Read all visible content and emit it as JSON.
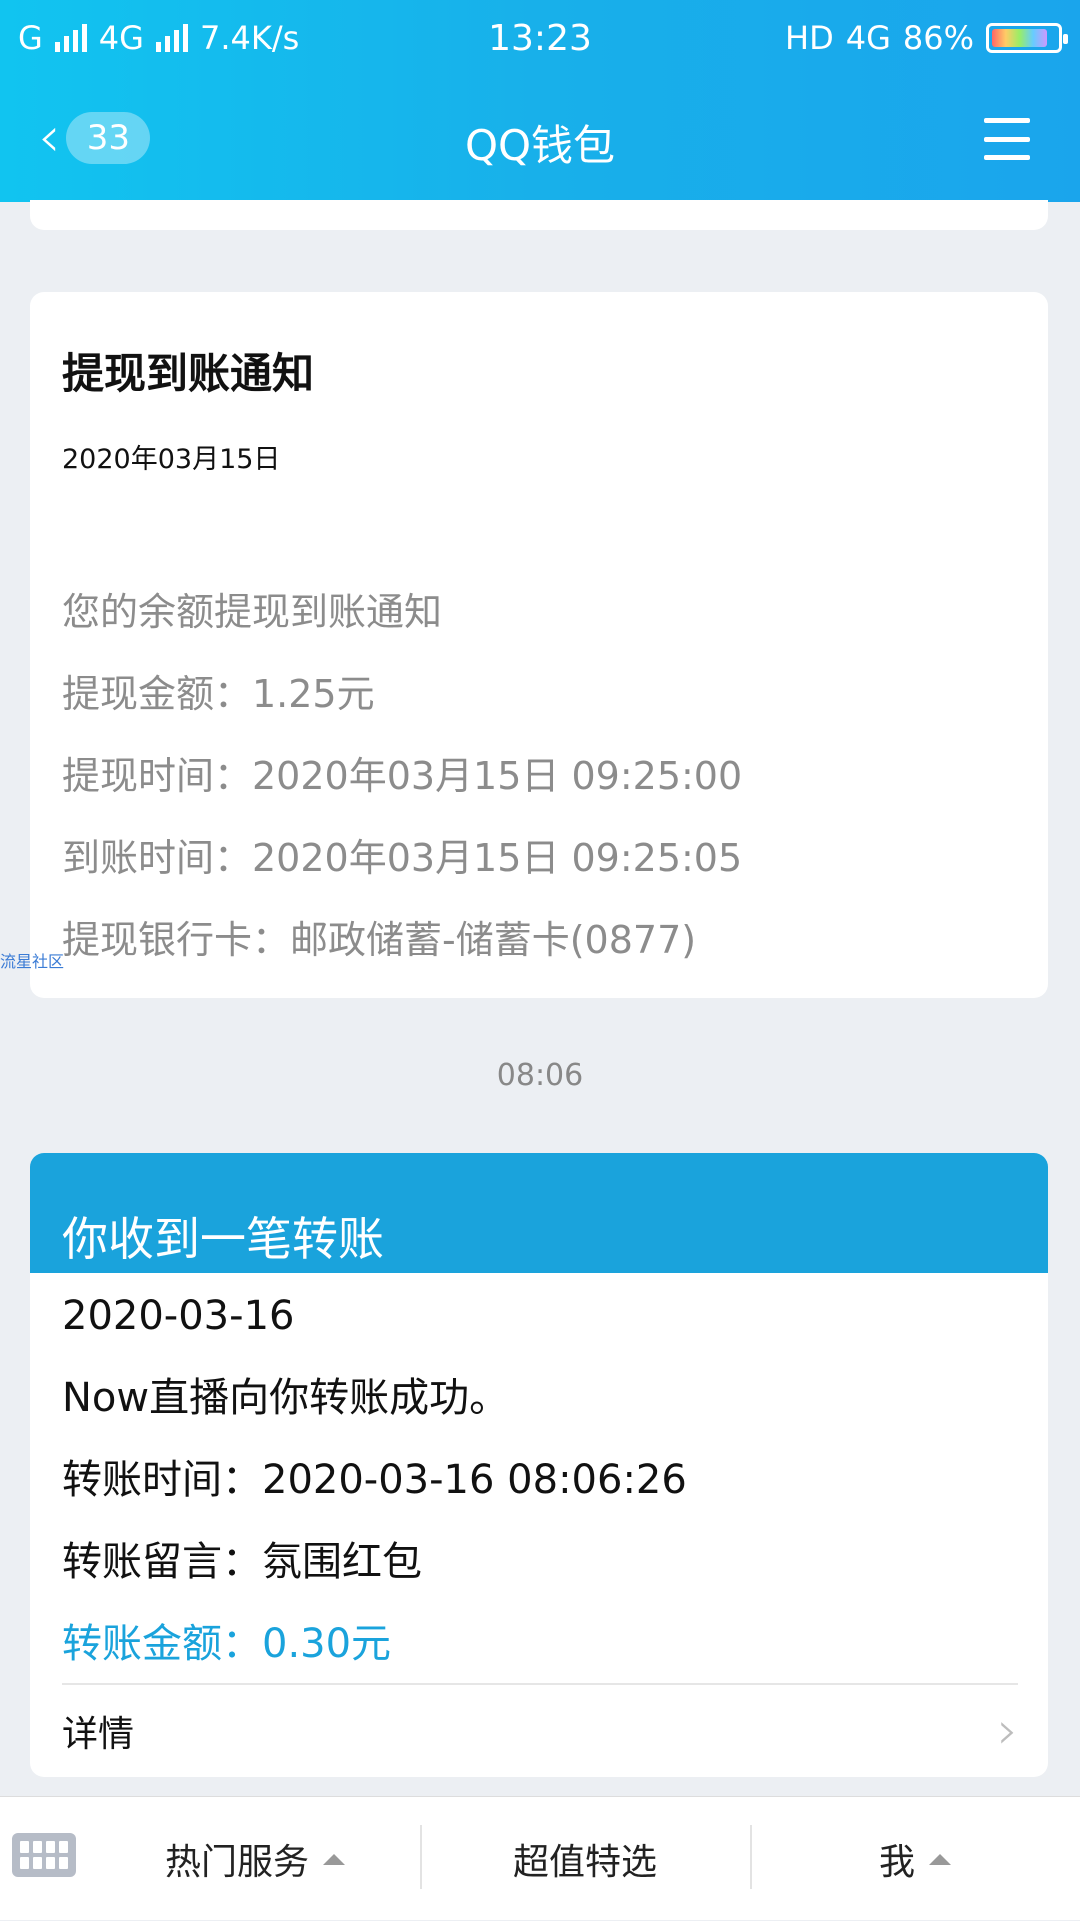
{
  "status_bar": {
    "carrier": "G",
    "network": "4G",
    "speed": "7.4K/s",
    "time": "13:23",
    "hd": "HD",
    "network2": "4G",
    "battery": "86%",
    "battery_level": 0.86
  },
  "nav": {
    "back_badge": "33",
    "title": "QQ钱包"
  },
  "withdraw_card": {
    "title": "提现到账通知",
    "date": "2020年03月15日",
    "lines": [
      "您的余额提现到账通知",
      "提现金额：1.25元",
      "提现时间：2020年03月15日 09:25:00",
      "到账时间：2020年03月15日 09:25:05",
      "提现银行卡：邮政储蓄-储蓄卡(0877)"
    ]
  },
  "watermark": "流星社区",
  "timestamp": "08:06",
  "transfer_card": {
    "header": "你收到一笔转账",
    "date": "2020-03-16",
    "message": "Now直播向你转账成功。",
    "time_line": "转账时间：2020-03-16 08:06:26",
    "note_line": "转账留言：氛围红包",
    "amount_line": "转账金额：0.30元",
    "detail_label": "详情"
  },
  "bottom_bar": {
    "tabs": [
      "热门服务",
      "超值特选",
      "我"
    ]
  },
  "colors": {
    "accent": "#1aa3dc",
    "header_gradient_start": "#11c4f0",
    "background": "#eceff3"
  }
}
